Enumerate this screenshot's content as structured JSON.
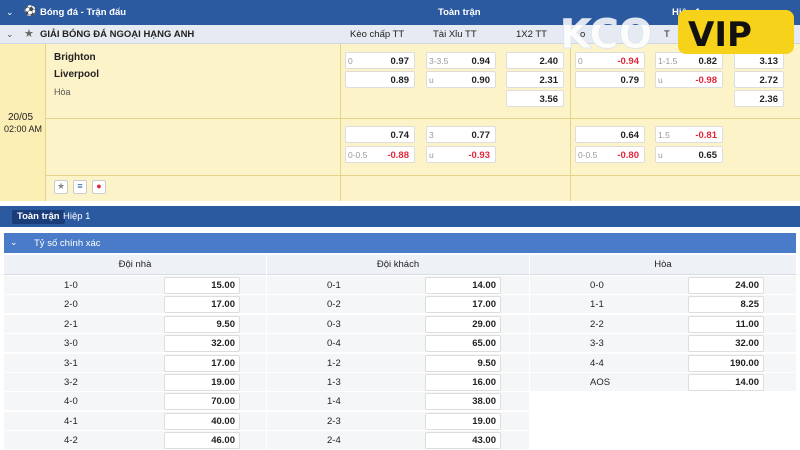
{
  "header": {
    "sport_title": "Bóng đá - Trận đấu",
    "full_match": "Toàn trận",
    "half": "Hiệp 1"
  },
  "league": {
    "name": "GIẢI BÓNG ĐÁ NGOẠI HẠNG ANH",
    "col_handicap": "Kèo chấp TT",
    "col_ou": "Tài Xỉu TT",
    "col_1x2": "1X2 TT"
  },
  "match": {
    "date": "20/05",
    "time": "02:00 AM",
    "home": "Brighton",
    "away": "Liverpool",
    "draw": "Hòa",
    "ft_hdp_line": "0",
    "ft_hdp_home": "0.97",
    "ft_hdp_away": "0.89",
    "ft_ou_line": "3-3.5",
    "ft_ou_over": "0.94",
    "ft_ou_under_label": "u",
    "ft_ou_under": "0.90",
    "ft_1x2_home": "2.40",
    "ft_1x2_away": "2.31",
    "ft_1x2_draw": "3.56",
    "h1_hdp_line": "0",
    "h1_hdp_home": "-0.94",
    "h1_hdp_away": "0.79",
    "h1_ou_line": "1-1.5",
    "h1_ou_over": "0.82",
    "h1_ou_under_label": "u",
    "h1_ou_under": "-0.98",
    "h1_1x2_home": "3.13",
    "h1_1x2_away": "2.72",
    "h1_1x2_draw": "2.36",
    "alt_ft_hdp_home": "0.74",
    "alt_ft_hdp_line": "0-0.5",
    "alt_ft_hdp_away": "-0.88",
    "alt_ft_ou_line": "3",
    "alt_ft_ou_over": "0.77",
    "alt_ft_ou_under_label": "u",
    "alt_ft_ou_under": "-0.93",
    "alt_h1_hdp_home": "0.64",
    "alt_h1_hdp_line": "0-0.5",
    "alt_h1_hdp_away": "-0.80",
    "alt_h1_ou_line": "1.5",
    "alt_h1_ou_over": "-0.81",
    "alt_h1_ou_under_label": "u",
    "alt_h1_ou_under": "0.65"
  },
  "tabs": [
    "Toàn trận",
    "Hiệp 1"
  ],
  "correct_score": {
    "title": "Tỷ số chính xác",
    "headers": [
      "Đội nhà",
      "Đội khách",
      "Hòa"
    ],
    "home": [
      [
        "1-0",
        "15.00"
      ],
      [
        "2-0",
        "17.00"
      ],
      [
        "2-1",
        "9.50"
      ],
      [
        "3-0",
        "32.00"
      ],
      [
        "3-1",
        "17.00"
      ],
      [
        "3-2",
        "19.00"
      ],
      [
        "4-0",
        "70.00"
      ],
      [
        "4-1",
        "40.00"
      ],
      [
        "4-2",
        "46.00"
      ]
    ],
    "away": [
      [
        "0-1",
        "14.00"
      ],
      [
        "0-2",
        "17.00"
      ],
      [
        "0-3",
        "29.00"
      ],
      [
        "0-4",
        "65.00"
      ],
      [
        "1-2",
        "9.50"
      ],
      [
        "1-3",
        "16.00"
      ],
      [
        "1-4",
        "38.00"
      ],
      [
        "2-3",
        "19.00"
      ],
      [
        "2-4",
        "43.00"
      ]
    ],
    "draw": [
      [
        "0-0",
        "24.00"
      ],
      [
        "1-1",
        "8.25"
      ],
      [
        "2-2",
        "11.00"
      ],
      [
        "3-3",
        "32.00"
      ],
      [
        "4-4",
        "190.00"
      ],
      [
        "AOS",
        "14.00"
      ]
    ]
  },
  "logo_text": "KCOVIP",
  "colors": {
    "header_blue": "#2c5aa0",
    "match_bg": "#fdf3c8",
    "negative": "#e0283c",
    "logo_yellow": "#f6d21b"
  }
}
